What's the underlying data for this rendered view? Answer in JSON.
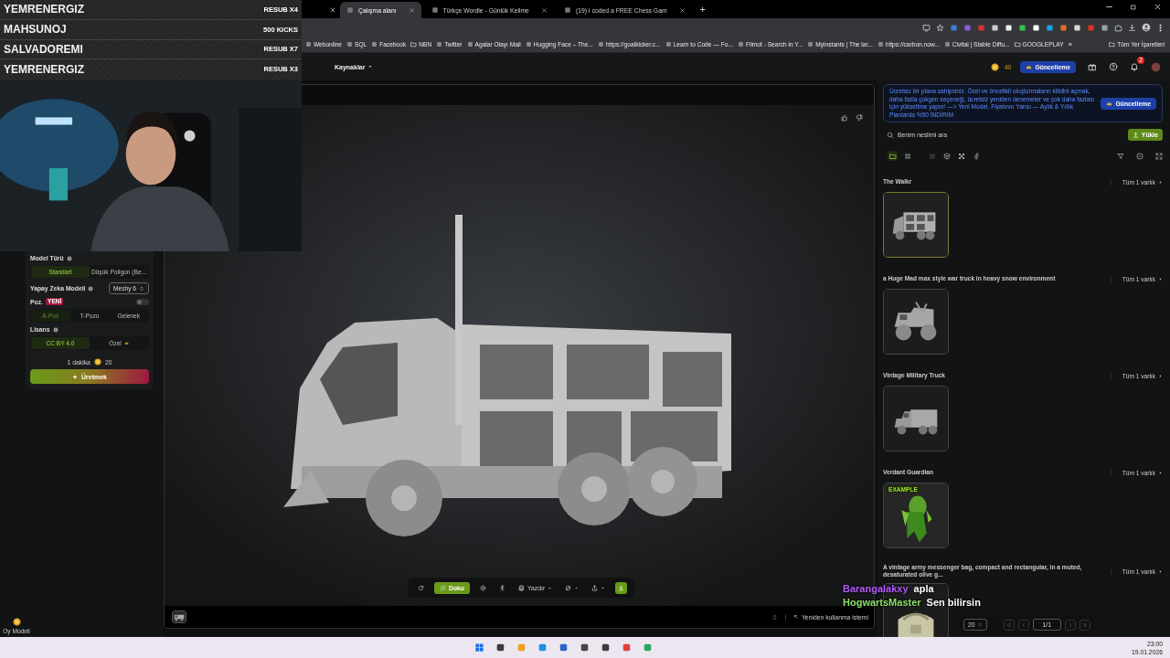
{
  "stream_overlay": {
    "alerts": [
      {
        "name": "YEMRENERGIZ",
        "event": "RESUB X4"
      },
      {
        "name": "MAHSUNOJ",
        "event": "500 KICKS"
      },
      {
        "name": "SALVADOREMI",
        "event": "RESUB X7"
      },
      {
        "name": "YEMRENERGIZ",
        "event": "RESUB X3"
      }
    ]
  },
  "browser": {
    "tabs": [
      {
        "title": "Çalışma alanı",
        "selected": true
      },
      {
        "title": "Türkçe Wordle - Günlük Kelime",
        "selected": false
      },
      {
        "title": "(19) I coded a FREE Chess Gam",
        "selected": false
      }
    ],
    "new_tab": "+",
    "bookmarks": [
      {
        "label": "Webonline",
        "kind": "site"
      },
      {
        "label": "SQL",
        "kind": "site"
      },
      {
        "label": "Facebook",
        "kind": "site"
      },
      {
        "label": "NBN",
        "kind": "folder"
      },
      {
        "label": "Twitter",
        "kind": "site"
      },
      {
        "label": "Agalar Olayı Mail",
        "kind": "site"
      },
      {
        "label": "Hugging Face – The...",
        "kind": "site"
      },
      {
        "label": "https://goalkicker.c...",
        "kind": "site"
      },
      {
        "label": "Learn to Code — Fo...",
        "kind": "site"
      },
      {
        "label": "Filmot - Search in Y...",
        "kind": "site"
      },
      {
        "label": "Myinstants | The lar...",
        "kind": "site"
      },
      {
        "label": "https://carbon.now...",
        "kind": "site"
      },
      {
        "label": "Civitai | Stable Diffu...",
        "kind": "site"
      },
      {
        "label": "GOOGLEPLAY",
        "kind": "folder"
      }
    ],
    "more": "»",
    "all_bookmarks": "Tüm Yer İşaretleri"
  },
  "app_header": {
    "menus": [
      {
        "label": "Kaynaklar"
      }
    ],
    "credits": "40",
    "upgrade": "Güncelleme",
    "notification_count": "2"
  },
  "generator": {
    "model_type": {
      "label": "Model Türü",
      "options": [
        {
          "label": "Standart",
          "selected": true
        },
        {
          "label": "Düşük Poligon (Be...",
          "selected": false
        }
      ]
    },
    "ai_model": {
      "label": "Yapay Zeka Modeli",
      "value": "Meshy 6"
    },
    "pose": {
      "label": "Poz.",
      "badge": "YENİ",
      "on": false,
      "options": [
        {
          "label": "A-Poz",
          "selected": true
        },
        {
          "label": "T-Pozu",
          "selected": false
        },
        {
          "label": "Gelenek",
          "selected": false
        }
      ]
    },
    "license": {
      "label": "Lisans",
      "options": [
        {
          "label": "CC BY 4.0",
          "selected": true
        },
        {
          "label": "Özel",
          "selected": false
        }
      ]
    },
    "duration": "1 dakika",
    "cost": "20",
    "generate": "Üretmek"
  },
  "vote": {
    "label": "Oy Modeli"
  },
  "viewer": {
    "toolbar": [
      {
        "kind": "refresh",
        "selected": false
      },
      {
        "kind": "texture",
        "label": "Doku",
        "selected": true
      },
      {
        "kind": "lighting",
        "selected": false
      },
      {
        "kind": "rig",
        "selected": false
      },
      {
        "kind": "print",
        "label": "Yazdır",
        "selected": false
      },
      {
        "kind": "remesh",
        "selected": false
      },
      {
        "kind": "share",
        "selected": false
      },
      {
        "kind": "download",
        "selected": false
      }
    ],
    "reuse_prompt": "Yeniden kullanma istemi"
  },
  "assets": {
    "banner": {
      "text": "Ücretsiz bir plana sahipsiniz. Özel ve öncelikli oluşturmaların kilidini açmak, daha fazla çokgen seçeneği, ücretsiz yeniden denemeler ve çok daha fazlası için yükseltme yapın! —> Yeni Model, Fiyatının Yarısı — Aylık & Yıllık Planlarda %50 İNDİRİM",
      "button": "Güncelleme"
    },
    "search": {
      "placeholder": "Benim neslimi ara"
    },
    "upload": "Yükle",
    "views": [
      {
        "kind": "folder",
        "selected": true
      },
      {
        "kind": "grid",
        "selected": false
      },
      {
        "kind": "dots",
        "selected": false
      },
      {
        "kind": "cube",
        "selected": false
      },
      {
        "kind": "checker",
        "selected": false
      },
      {
        "kind": "runner",
        "selected": false
      }
    ],
    "groups": [
      {
        "title": "The Walkr",
        "count": "Tüm 1 varlık",
        "kind": "box_truck",
        "selected": true
      },
      {
        "title": "a Huge Mad max style war truck in heavy snow environment",
        "count": "Tüm 1 varlık",
        "kind": "war_truck",
        "selected": false
      },
      {
        "title": "Vintage Military Truck",
        "count": "Tüm 1 varlık",
        "kind": "military_truck",
        "selected": false
      },
      {
        "title": "Verdant Guardian",
        "count": "Tüm 1 varlık",
        "kind": "creature",
        "badge": "EXAMPLE",
        "selected": false
      },
      {
        "title": "A vintage army messenger bag, compact and rectangular, in a muted, desaturated olive g...",
        "count": "Tüm 1 varlık",
        "kind": "bag",
        "selected": false
      }
    ],
    "page_size": "20",
    "page": "1/1"
  },
  "chat": [
    {
      "user": "Barangalakxy",
      "message": "apla",
      "color": "#b65cff"
    },
    {
      "user": "HogwartsMaster",
      "message": "Sen bilirsin",
      "color": "#8ee06a"
    }
  ],
  "taskbar": {
    "time": "23:00",
    "date": "19.01.2026"
  }
}
